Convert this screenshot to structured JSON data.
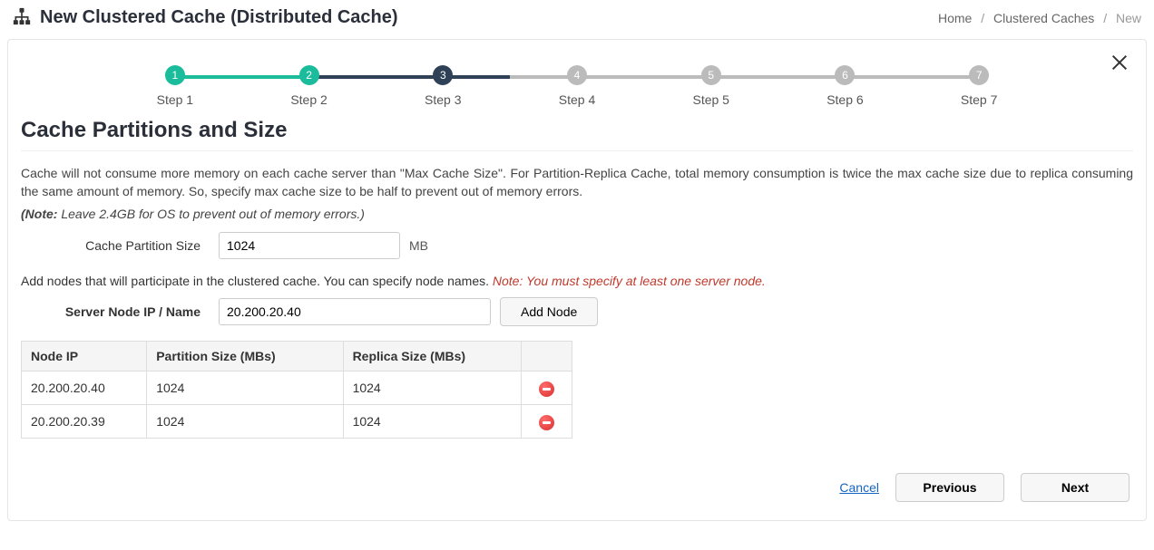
{
  "header": {
    "title": "New Clustered Cache (Distributed Cache)"
  },
  "breadcrumb": {
    "home": "Home",
    "mid": "Clustered Caches",
    "current": "New"
  },
  "stepper": {
    "steps": [
      {
        "num": "1",
        "label": "Step 1"
      },
      {
        "num": "2",
        "label": "Step 2"
      },
      {
        "num": "3",
        "label": "Step 3"
      },
      {
        "num": "4",
        "label": "Step 4"
      },
      {
        "num": "5",
        "label": "Step 5"
      },
      {
        "num": "6",
        "label": "Step 6"
      },
      {
        "num": "7",
        "label": "Step 7"
      }
    ]
  },
  "section": {
    "title": "Cache Partitions and Size",
    "desc": "Cache will not consume more memory on each cache server than \"Max Cache Size\". For Partition-Replica Cache, total memory consumption is twice the max cache size due to replica consuming the same amount of memory. So, specify max cache size to be half to prevent out of memory errors.",
    "note_bold": "(Note:",
    "note_rest": " Leave 2.4GB for OS to prevent out of memory errors.)",
    "partition_label": "Cache Partition Size",
    "partition_value": "1024",
    "partition_suffix": "MB",
    "addnodes_text": "Add nodes that will participate in the clustered cache. You can specify node names. ",
    "addnodes_red": "Note: You must specify at least one server node.",
    "server_label": "Server Node IP / Name",
    "server_value": "20.200.20.40",
    "addnode_btn": "Add Node"
  },
  "table": {
    "headers": {
      "ip": "Node IP",
      "partition": "Partition Size (MBs)",
      "replica": "Replica Size (MBs)"
    },
    "rows": [
      {
        "ip": "20.200.20.40",
        "partition": "1024",
        "replica": "1024"
      },
      {
        "ip": "20.200.20.39",
        "partition": "1024",
        "replica": "1024"
      }
    ]
  },
  "footer": {
    "cancel": "Cancel",
    "prev": "Previous",
    "next": "Next"
  }
}
